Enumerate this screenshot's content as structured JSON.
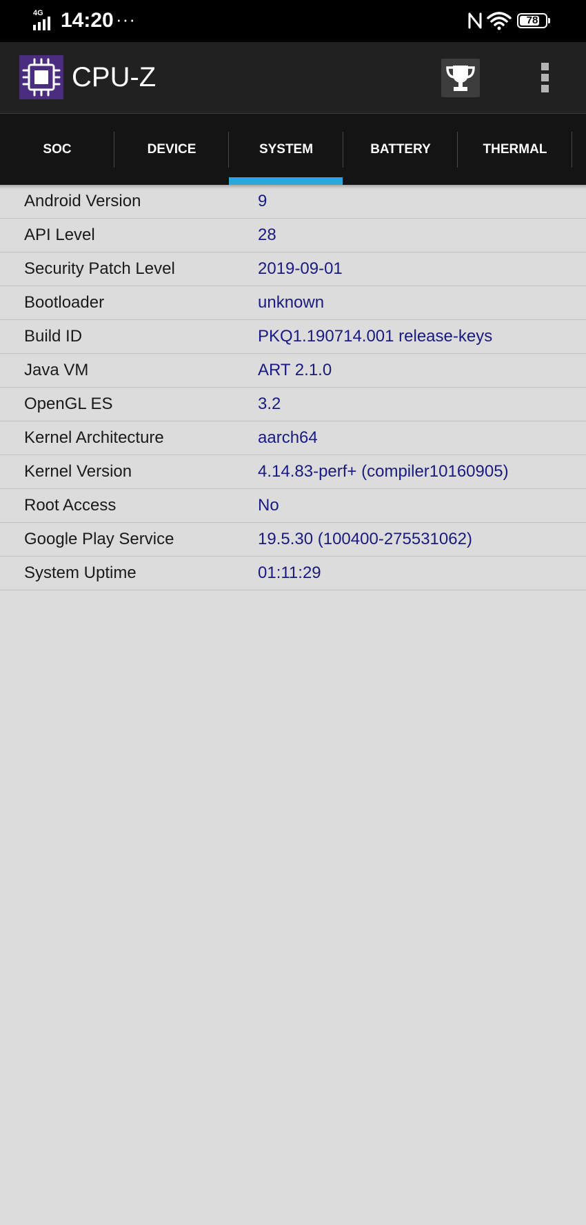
{
  "status_bar": {
    "network_type": "4G",
    "time": "14:20",
    "more": "···",
    "battery_text": "78",
    "battery_level": 0.78
  },
  "app": {
    "title": "CPU-Z",
    "logo_icon": "cpu-chip-icon",
    "trophy_icon": "trophy-icon",
    "menu_icon": "overflow-menu-icon"
  },
  "tabs": [
    {
      "label": "SOC",
      "active": false
    },
    {
      "label": "DEVICE",
      "active": false
    },
    {
      "label": "SYSTEM",
      "active": true
    },
    {
      "label": "BATTERY",
      "active": false
    },
    {
      "label": "THERMAL",
      "active": false
    }
  ],
  "colors": {
    "accent": "#2ba6de",
    "value_text": "#1a1a80",
    "app_bar": "#212121",
    "tab_bar": "#141414",
    "logo_bg": "#4a2d7e"
  },
  "system_info": [
    {
      "label": "Android Version",
      "value": "9"
    },
    {
      "label": "API Level",
      "value": "28"
    },
    {
      "label": "Security Patch Level",
      "value": "2019-09-01"
    },
    {
      "label": "Bootloader",
      "value": "unknown"
    },
    {
      "label": "Build ID",
      "value": "PKQ1.190714.001 release-keys"
    },
    {
      "label": "Java VM",
      "value": "ART 2.1.0"
    },
    {
      "label": "OpenGL ES",
      "value": "3.2"
    },
    {
      "label": "Kernel Architecture",
      "value": "aarch64"
    },
    {
      "label": "Kernel Version",
      "value": "4.14.83-perf+ (compiler10160905)"
    },
    {
      "label": "Root Access",
      "value": "No"
    },
    {
      "label": "Google Play Service",
      "value": "19.5.30 (100400-275531062)"
    },
    {
      "label": "System Uptime",
      "value": "01:11:29"
    }
  ]
}
